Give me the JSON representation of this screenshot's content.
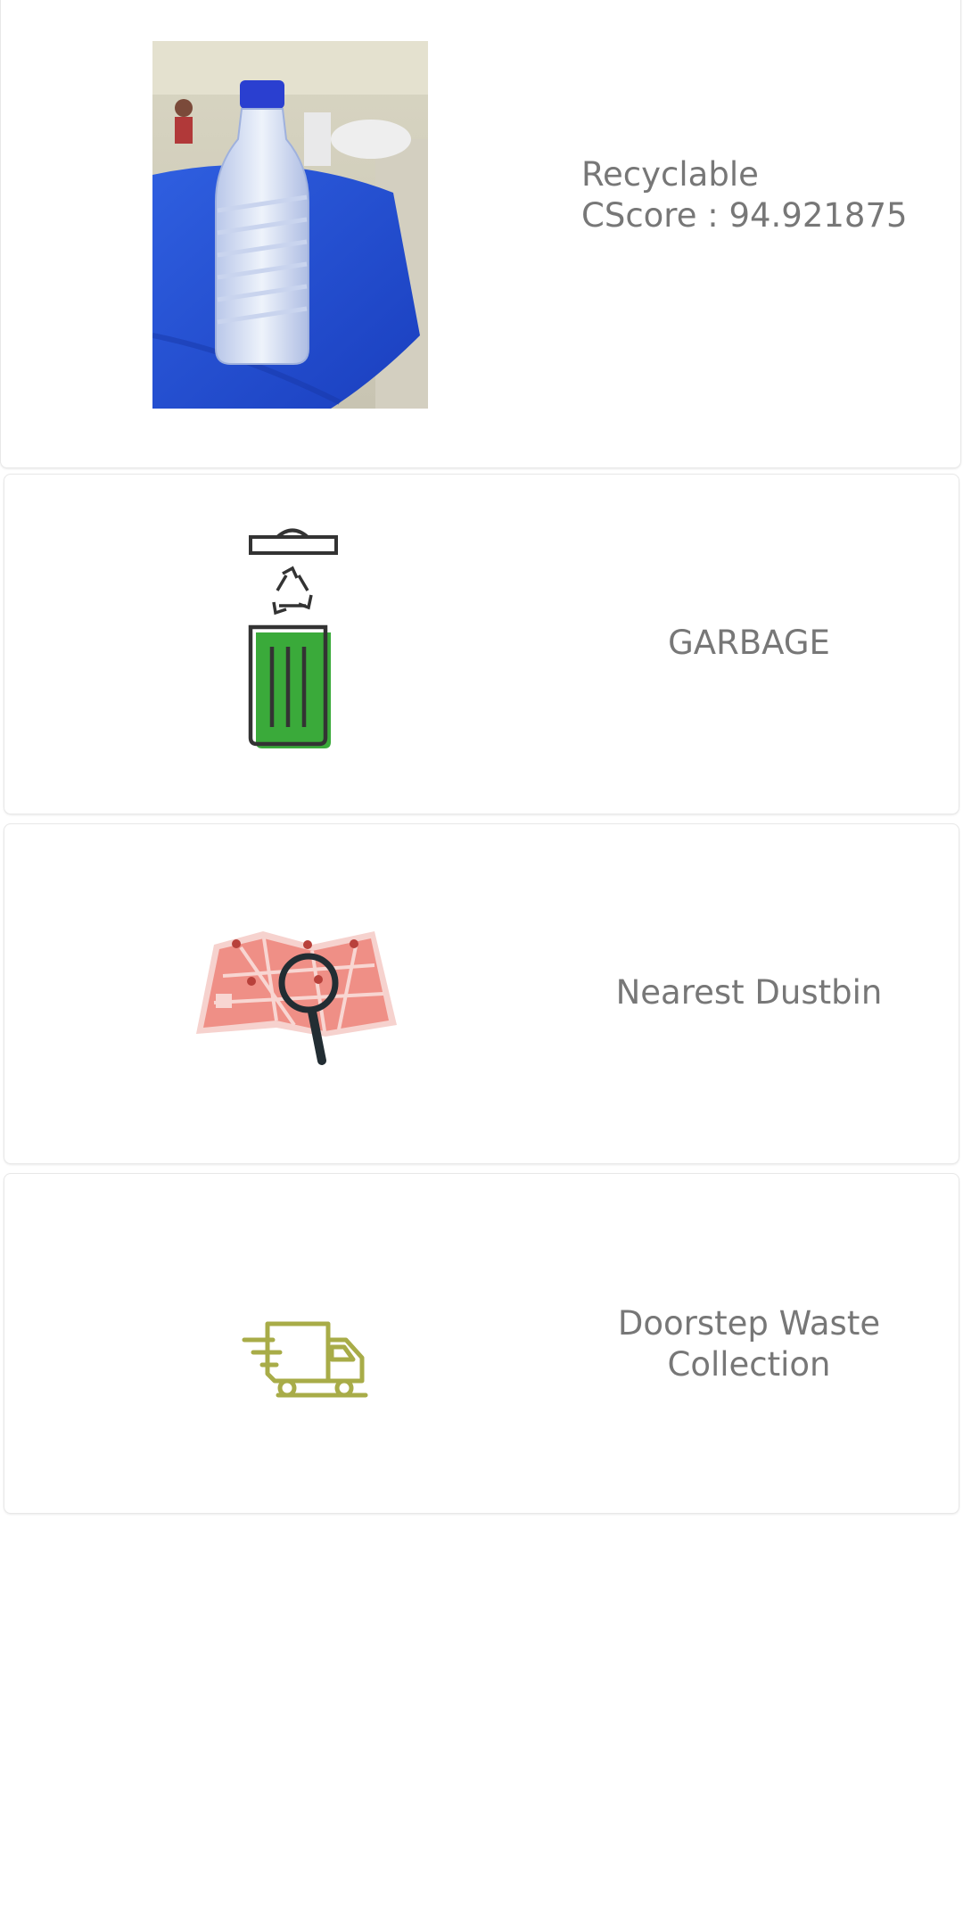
{
  "cards": {
    "result": {
      "label_line1": "Recyclable",
      "label_line2": "CScore : 94.921875",
      "image_icon": "water-bottle-photo"
    },
    "garbage": {
      "label": "GARBAGE",
      "icon": "recycle-bin-icon",
      "accent": "#3aaa3a"
    },
    "dustbin": {
      "label": "Nearest Dustbin",
      "icon": "map-search-icon",
      "accent": "#ef8f86"
    },
    "doorstep": {
      "label_line1": "Doorstep Waste",
      "label_line2": "Collection",
      "icon": "delivery-truck-icon",
      "accent": "#a8ac48"
    }
  }
}
